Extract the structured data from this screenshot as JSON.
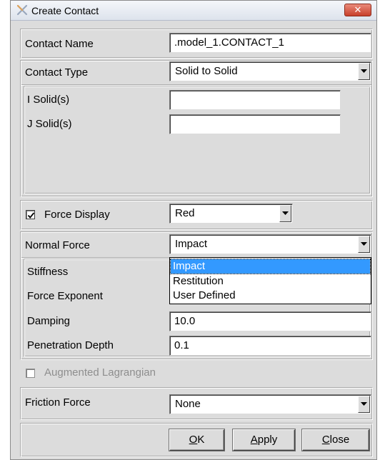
{
  "window": {
    "title": "Create Contact",
    "close_glyph": "✕"
  },
  "contact_name": {
    "label": "Contact Name",
    "value": ".model_1.CONTACT_1"
  },
  "contact_type": {
    "label": "Contact Type",
    "value": "Solid to Solid"
  },
  "i_solids": {
    "label": "I Solid(s)",
    "value": ""
  },
  "j_solids": {
    "label": "J Solid(s)",
    "value": ""
  },
  "force_display": {
    "label": "Force Display",
    "checked": true,
    "value": "Red"
  },
  "normal_force": {
    "label": "Normal Force",
    "value": "Impact",
    "options": [
      "Impact",
      "Restitution",
      "User Defined"
    ],
    "highlighted": "Impact"
  },
  "stiffness": {
    "label": "Stiffness"
  },
  "force_exponent": {
    "label": "Force Exponent"
  },
  "damping": {
    "label": "Damping",
    "value": "10.0"
  },
  "penetration_depth": {
    "label": "Penetration Depth",
    "value": "0.1"
  },
  "augmented_lagrangian": {
    "label": "Augmented Lagrangian",
    "checked": false,
    "enabled": false
  },
  "friction_force": {
    "label": "Friction Force",
    "value": "None"
  },
  "buttons": {
    "ok": {
      "mnemonic": "O",
      "rest": "K"
    },
    "apply": {
      "mnemonic": "A",
      "rest": "pply"
    },
    "close": {
      "mnemonic": "C",
      "rest": "lose"
    }
  }
}
